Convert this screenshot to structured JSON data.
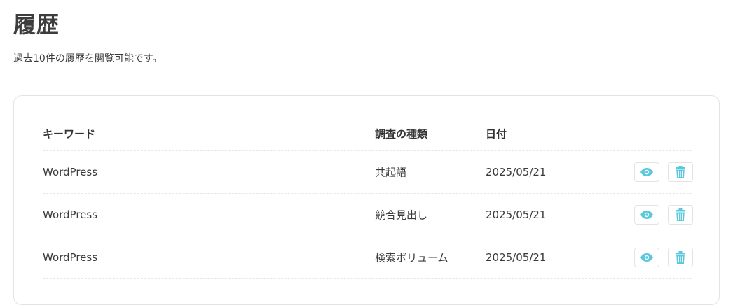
{
  "page": {
    "title": "履歴",
    "description": "過去10件の履歴を閲覧可能です。"
  },
  "table": {
    "headers": {
      "keyword": "キーワード",
      "type": "調査の種類",
      "date": "日付"
    },
    "rows": [
      {
        "keyword": "WordPress",
        "type": "共起語",
        "date": "2025/05/21"
      },
      {
        "keyword": "WordPress",
        "type": "競合見出し",
        "date": "2025/05/21"
      },
      {
        "keyword": "WordPress",
        "type": "検索ボリューム",
        "date": "2025/05/21"
      }
    ]
  },
  "icons": {
    "view": "eye-icon",
    "delete": "trash-icon"
  },
  "colors": {
    "accent": "#5bc8dc"
  }
}
